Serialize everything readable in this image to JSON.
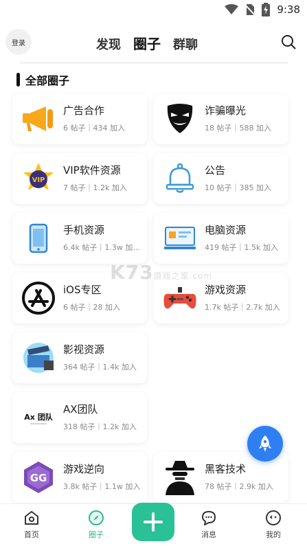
{
  "status_bar": {
    "time": "9:38"
  },
  "header": {
    "login_label": "登录",
    "tabs": [
      {
        "label": "发现",
        "active": false
      },
      {
        "label": "圈子",
        "active": true
      },
      {
        "label": "群聊",
        "active": false
      }
    ]
  },
  "section": {
    "title": "全部圈子"
  },
  "circles": [
    {
      "name": "广告合作",
      "meta": "6 帖子｜434 加入",
      "icon": "megaphone-icon"
    },
    {
      "name": "诈骗曝光",
      "meta": "18 帖子｜588 加入",
      "icon": "mask-icon"
    },
    {
      "name": "VIP软件资源",
      "meta": "7 帖子｜1.2k 加入",
      "icon": "vip-badge-icon"
    },
    {
      "name": "公告",
      "meta": "10 帖子｜385 加入",
      "icon": "bell-icon"
    },
    {
      "name": "手机资源",
      "meta": "6.4k 帖子｜1.3w 加...",
      "icon": "phone-icon"
    },
    {
      "name": "电脑资源",
      "meta": "419 帖子｜1.5k 加入",
      "icon": "computer-icon"
    },
    {
      "name": "iOS专区",
      "meta": "6 帖子｜28 加入",
      "icon": "app-store-icon"
    },
    {
      "name": "游戏资源",
      "meta": "1.7k 帖子｜2.7k 加入",
      "icon": "gamepad-icon"
    },
    {
      "name": "影视资源",
      "meta": "364 帖子｜1.4k 加入",
      "icon": "clapperboard-icon"
    },
    {
      "name": "AX团队",
      "meta": "318 帖子｜1.2k 加入",
      "icon": "ax-team-logo"
    },
    {
      "name": "游戏逆向",
      "meta": "3.8k 帖子｜1.1w 加入",
      "icon": "gg-logo-icon"
    },
    {
      "name": "黑客技术",
      "meta": "78 帖子｜2.9k 加入",
      "icon": "hacker-spy-icon"
    }
  ],
  "logo_text": {
    "ax": "Ax 团队",
    "gg": "GG",
    "vip": "VIP"
  },
  "watermark": {
    "main": "K73",
    "sub": "游戏之家",
    "domain": ".com"
  },
  "bottom_nav": [
    {
      "label": "首页",
      "icon": "home-icon",
      "active": false
    },
    {
      "label": "圈子",
      "icon": "compass-icon",
      "active": true
    },
    {
      "label": "",
      "icon": "plus-icon",
      "active": false
    },
    {
      "label": "消息",
      "icon": "message-icon",
      "active": false
    },
    {
      "label": "我的",
      "icon": "profile-icon",
      "active": false
    }
  ],
  "colors": {
    "accent": "#2bc197",
    "fab": "#2f7ff3",
    "meta_text": "#888888"
  }
}
